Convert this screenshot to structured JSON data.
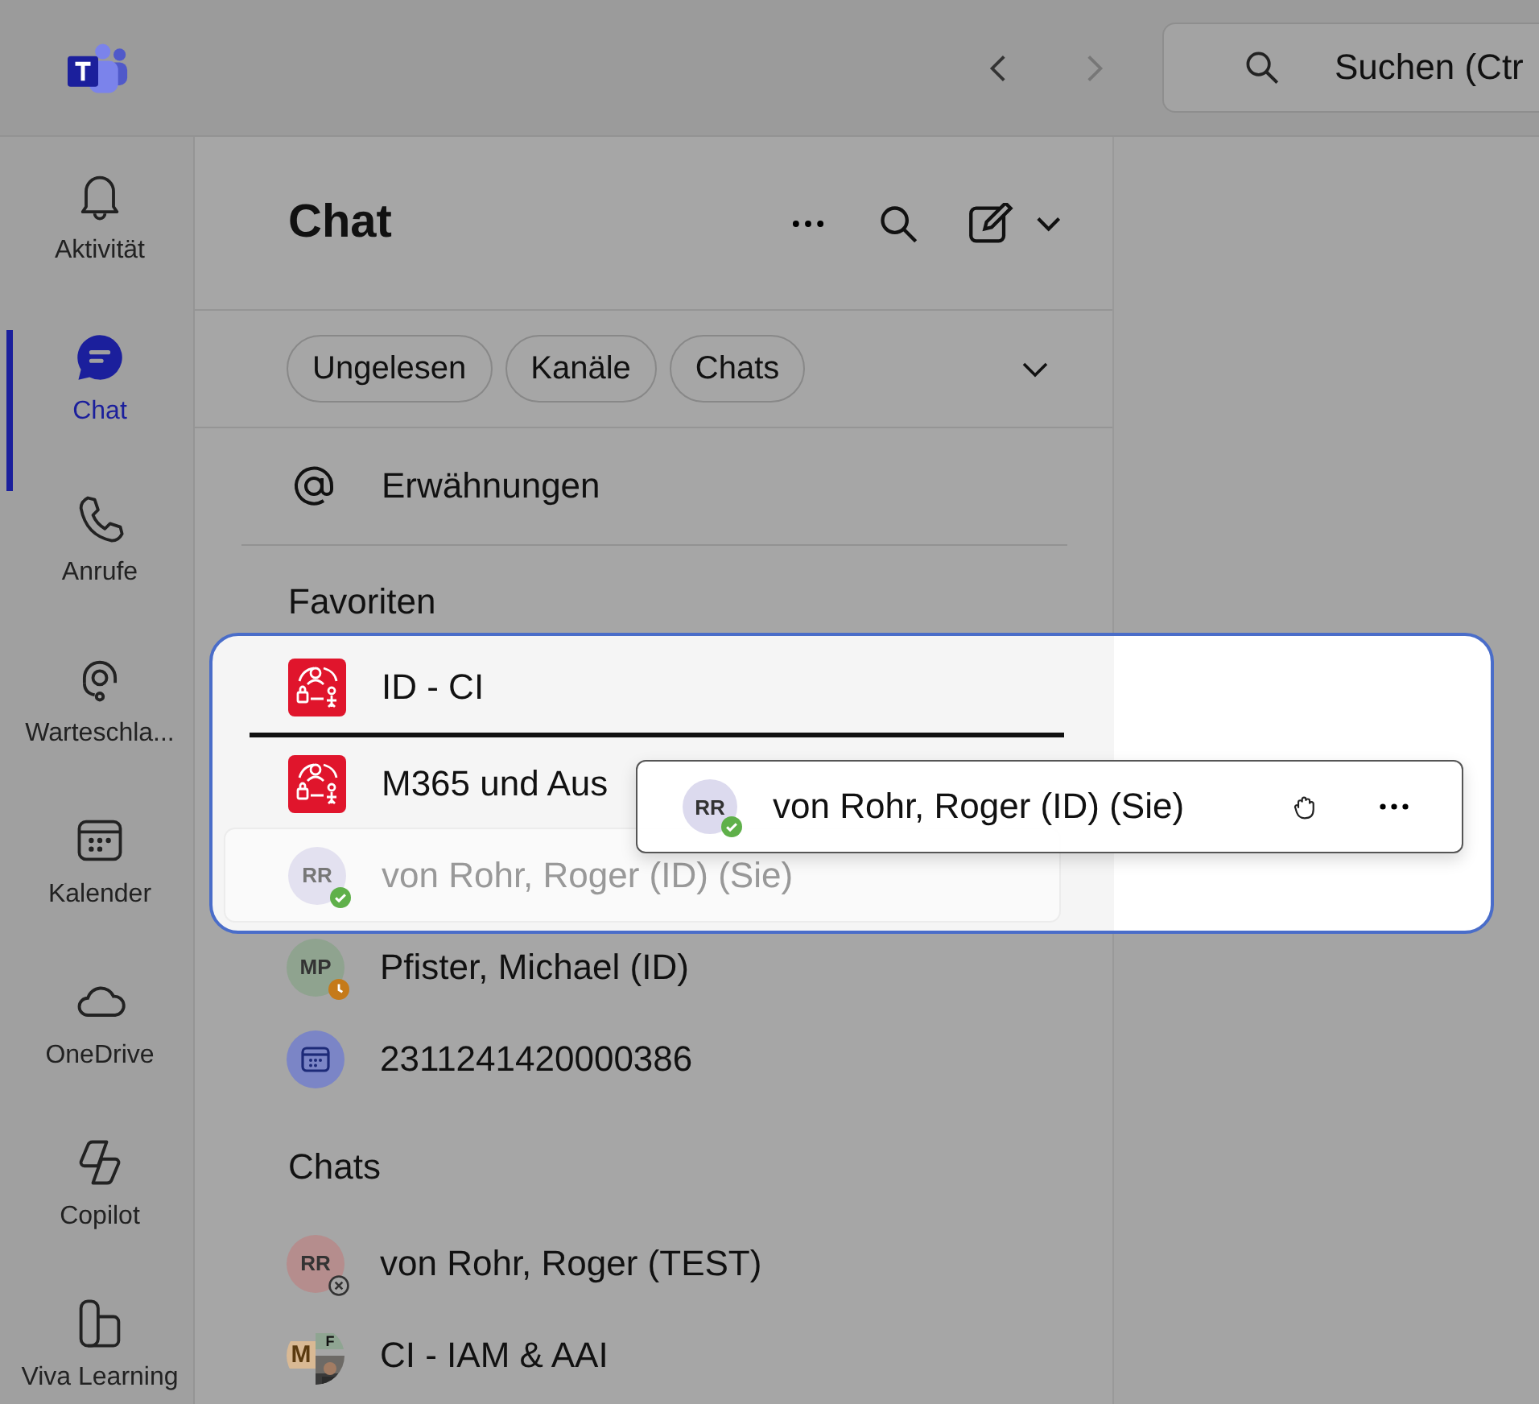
{
  "topbar": {
    "back_disabled": false,
    "forward_disabled": true,
    "search": {
      "placeholder": "Suchen (Ctr"
    }
  },
  "rail": [
    {
      "label": "Aktivität",
      "kind": "bell",
      "selected": false
    },
    {
      "label": "Chat",
      "kind": "chat",
      "selected": true
    },
    {
      "label": "Anrufe",
      "kind": "phone",
      "selected": false
    },
    {
      "label": "Warteschla...",
      "kind": "queue",
      "selected": false
    },
    {
      "label": "Kalender",
      "kind": "calendar",
      "selected": false
    },
    {
      "label": "OneDrive",
      "kind": "cloud",
      "selected": false
    },
    {
      "label": "Copilot",
      "kind": "copilot",
      "selected": false
    },
    {
      "label": "Viva Learning",
      "kind": "learning",
      "selected": false
    }
  ],
  "chat_list": {
    "title": "Chat",
    "filters": [
      {
        "label": "Ungelesen",
        "selected": false
      },
      {
        "label": "Kanäle",
        "selected": false
      },
      {
        "label": "Chats",
        "selected": false
      }
    ],
    "mentions": "Erwähnungen",
    "favorites": {
      "title": "Favoriten",
      "drop_zone": [
        {
          "name": "ID - CI",
          "avatar": {
            "kind": "team"
          },
          "drop_line_below": true,
          "dragging": false
        },
        {
          "name": "M365 und Aus",
          "avatar": {
            "kind": "team"
          },
          "drop_line_below": false,
          "dragging": false
        },
        {
          "name": "von Rohr, Roger (ID) (Sie)",
          "avatar": {
            "kind": "initials",
            "initials": "RR",
            "color": "#e3e1f0",
            "badge": {
              "kind": "available"
            }
          },
          "drop_line_below": false,
          "dragging": true
        }
      ],
      "items": [
        {
          "name": "Pfister, Michael (ID)",
          "avatar": {
            "kind": "initials",
            "initials": "MP",
            "color": "#8fa38f",
            "badge": {
              "kind": "away"
            }
          }
        },
        {
          "name": "2311241420000386",
          "avatar": {
            "kind": "calendar",
            "color": "#7b85c6"
          }
        }
      ]
    },
    "chats": {
      "title": "Chats",
      "items": [
        {
          "name": "von Rohr, Roger (TEST)",
          "avatar": {
            "kind": "initials",
            "initials": "RR",
            "color": "#b58d8d",
            "badge": {
              "kind": "offline"
            }
          }
        },
        {
          "name": "CI - IAM & AAI",
          "avatar": {
            "kind": "group",
            "initials": [
              "M",
              "F"
            ]
          }
        }
      ]
    }
  },
  "drag_preview": {
    "name": "von Rohr, Roger (ID) (Sie)",
    "avatar": {
      "kind": "initials",
      "initials": "RR",
      "color": "#dcdaee",
      "badge": {
        "kind": "available"
      }
    }
  }
}
